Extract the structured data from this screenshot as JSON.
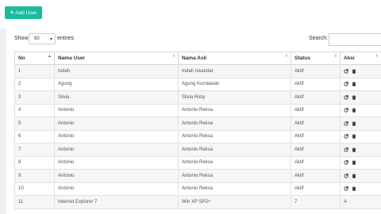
{
  "toolbar": {
    "add_user_label": "Add User"
  },
  "controls": {
    "show_label": "Show",
    "page_size": "50",
    "entries_label": "entries",
    "search_label": "Search:",
    "search_value": ""
  },
  "table": {
    "headers": [
      "No",
      "Nama User",
      "Nama Asli",
      "Status",
      "Aksi"
    ],
    "rows": [
      {
        "no": "1",
        "user": "Indah",
        "asli": "Indah Iskandar",
        "status": "Aktif",
        "aksi": "icons"
      },
      {
        "no": "2",
        "user": "Agung",
        "asli": "Agung Kurniawan",
        "status": "Aktif",
        "aksi": "icons"
      },
      {
        "no": "3",
        "user": "Silvia",
        "asli": "Silvia Risty",
        "status": "Aktif",
        "aksi": "icons"
      },
      {
        "no": "4",
        "user": "Antonio",
        "asli": "Antonio Reksa",
        "status": "Aktif",
        "aksi": "icons"
      },
      {
        "no": "5",
        "user": "Antonio",
        "asli": "Antonio Reksa",
        "status": "Aktif",
        "aksi": "icons"
      },
      {
        "no": "6",
        "user": "Antonio",
        "asli": "Antonio Reksa",
        "status": "Aktif",
        "aksi": "icons"
      },
      {
        "no": "7",
        "user": "Antonio",
        "asli": "Antonio Reksa",
        "status": "Aktif",
        "aksi": "icons"
      },
      {
        "no": "8",
        "user": "Antonio",
        "asli": "Antonio Reksa",
        "status": "Aktif",
        "aksi": "icons"
      },
      {
        "no": "9",
        "user": "Antonio",
        "asli": "Antonio Reksa",
        "status": "Aktif",
        "aksi": "icons"
      },
      {
        "no": "10",
        "user": "Antonio",
        "asli": "Antonio Reksa",
        "status": "Aktif",
        "aksi": "icons"
      },
      {
        "no": "11",
        "user": "Internet Explorer 7",
        "asli": "Win XP SP2+",
        "status": "7",
        "aksi": "A"
      }
    ]
  },
  "icons": {
    "add": "plus-icon",
    "edit": "edit-icon",
    "delete": "trash-icon",
    "sort": "sort-icon"
  },
  "colors": {
    "accent": "#1bbc9b",
    "background": "#eef0f3",
    "row_stripe": "#f6f6f6"
  }
}
